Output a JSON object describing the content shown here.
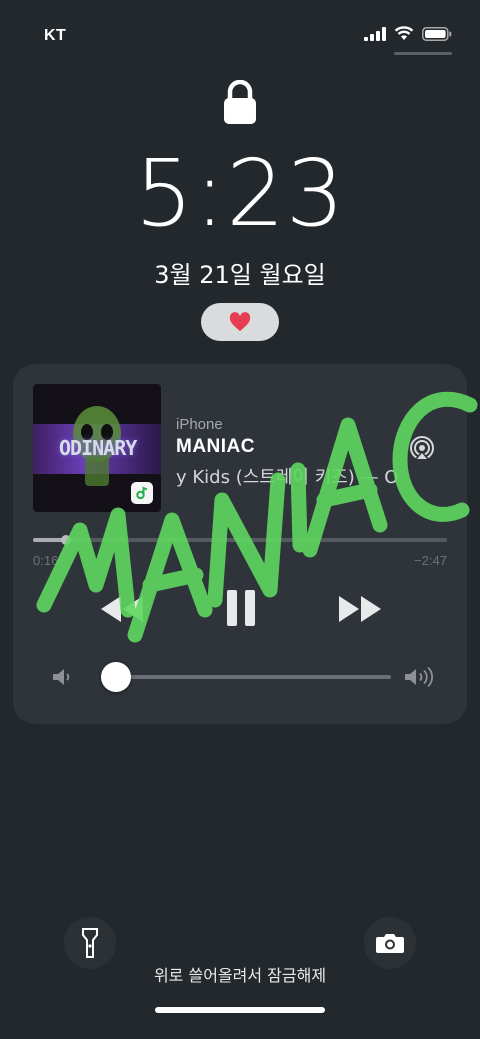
{
  "status_bar": {
    "carrier": "KT"
  },
  "lock_screen": {
    "time": "5:23",
    "date": "3월 21일 월요일",
    "unlock_hint": "위로 쓸어올려서 잠금해제"
  },
  "now_playing": {
    "source": "iPhone",
    "title": "MANIAC",
    "artist": "y Kids (스트레이 키즈) — O",
    "album_art_text": "ODINARY",
    "elapsed": "0:16",
    "remaining": "−2:47",
    "progress_fraction": 0.08,
    "volume_fraction": 0.05
  },
  "overlay": {
    "handwritten_text": "MANIAC"
  },
  "icons": [
    "signal-icon",
    "wifi-icon",
    "battery-icon",
    "lock-icon",
    "heart-icon",
    "airplay-icon",
    "previous-icon",
    "pause-icon",
    "next-icon",
    "volume-low-icon",
    "volume-high-icon",
    "flashlight-icon",
    "camera-icon",
    "music-app-icon"
  ],
  "colors": {
    "background": "#23282d",
    "card": "#2f343a",
    "heart": "#e63d53",
    "graffiti": "#5fd860"
  }
}
